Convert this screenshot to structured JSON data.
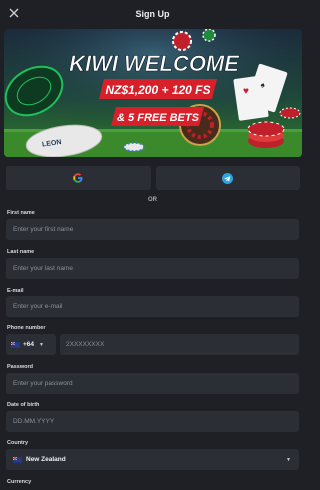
{
  "header": {
    "title": "Sign Up",
    "close_icon": "close-icon"
  },
  "banner": {
    "headline": "KIWI WELCOME",
    "offer": "NZ$1,200 + 120 FS",
    "bets": "& 5 FREE BETS",
    "brand": "LEON",
    "colors": {
      "headline": "#ffffff",
      "ribbon": "#d8202a",
      "field": "#2f7a2a"
    }
  },
  "social": {
    "google_icon": "google-icon",
    "telegram_icon": "telegram-icon"
  },
  "divider": {
    "or_label": "OR"
  },
  "form": {
    "first_name": {
      "label": "First name",
      "placeholder": "Enter your first name"
    },
    "last_name": {
      "label": "Last name",
      "placeholder": "Enter your last name"
    },
    "email": {
      "label": "E-mail",
      "placeholder": "Enter your e-mail"
    },
    "phone": {
      "label": "Phone number",
      "code": "+64",
      "placeholder": "2XXXXXXXX",
      "flag_icon": "new-zealand-flag-icon"
    },
    "password": {
      "label": "Password",
      "placeholder": "Enter your password"
    },
    "dob": {
      "label": "Date of birth",
      "placeholder": "DD.MM.YYYY"
    },
    "country": {
      "label": "Country",
      "value": "New Zealand",
      "flag_icon": "new-zealand-flag-icon"
    },
    "currency": {
      "label": "Currency"
    }
  },
  "colors": {
    "background": "#1f2025",
    "field": "#2c2e35",
    "text": "#e8e9ec",
    "placeholder": "#8c9099"
  }
}
